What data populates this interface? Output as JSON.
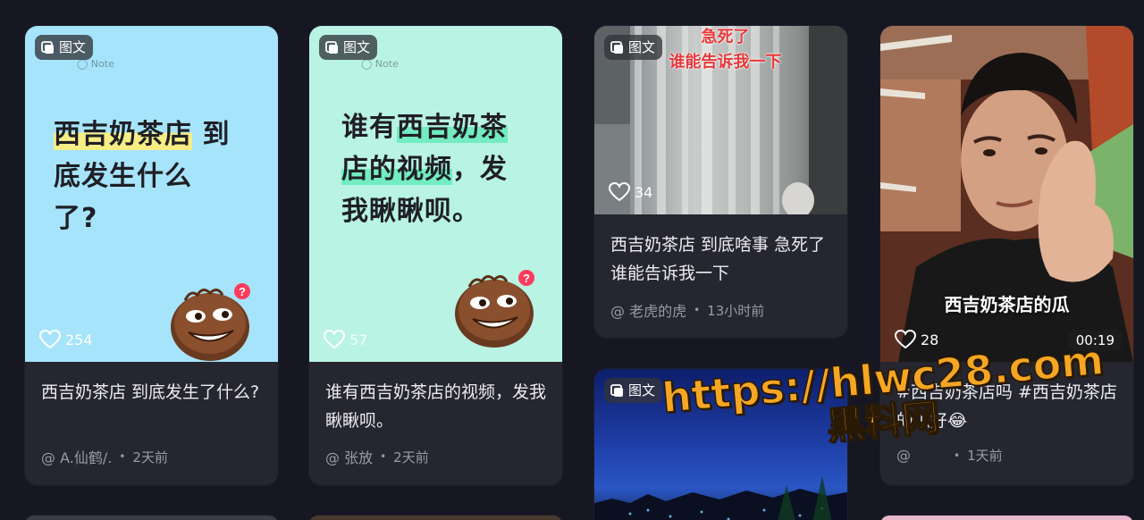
{
  "badge_label": "图文",
  "note_mark": "◯ Note",
  "cards": [
    {
      "cover_line1_hl": "西吉奶茶店",
      "cover_line1_rest": " 到",
      "cover_line2": "底发生什么",
      "cover_line3": "了?",
      "likes": "254",
      "title": "西吉奶茶店 到底发生了什么?",
      "author": "@ A.仙鹤/.",
      "time": "2天前"
    },
    {
      "cover_line1_pre": "谁有",
      "cover_line1_hl": "西吉奶茶",
      "cover_line2_hl": "店的视频",
      "cover_line2_rest": "，发",
      "cover_line3": "我瞅瞅呗。",
      "likes": "57",
      "title": "谁有西吉奶茶店的视频，发我瞅瞅呗。",
      "author": "@ 张放",
      "time": "2天前"
    },
    {
      "caption_line1": "急死了",
      "caption_line2": "谁能告诉我一下",
      "likes": "34",
      "title": "西吉奶茶店 到底啥事 急死了 谁能告诉我一下",
      "author": "@ 老虎的虎",
      "time": "13小时前"
    },
    {
      "caption": "西吉奶茶店的瓜",
      "likes": "28",
      "duration": "00:19",
      "title": "#西吉奶茶店吗 #西吉奶茶店的瓜好😂",
      "author": "@",
      "time": "1天前"
    }
  ],
  "watermark": {
    "line1": "https://hlwc28.com",
    "line2": "黑料网"
  },
  "colors": {
    "page_bg": "#161722",
    "card_bg": "#25262f",
    "card1_cover": "#a6e4fb",
    "card2_cover": "#b8f3e3",
    "watermark": "#f5a623"
  }
}
